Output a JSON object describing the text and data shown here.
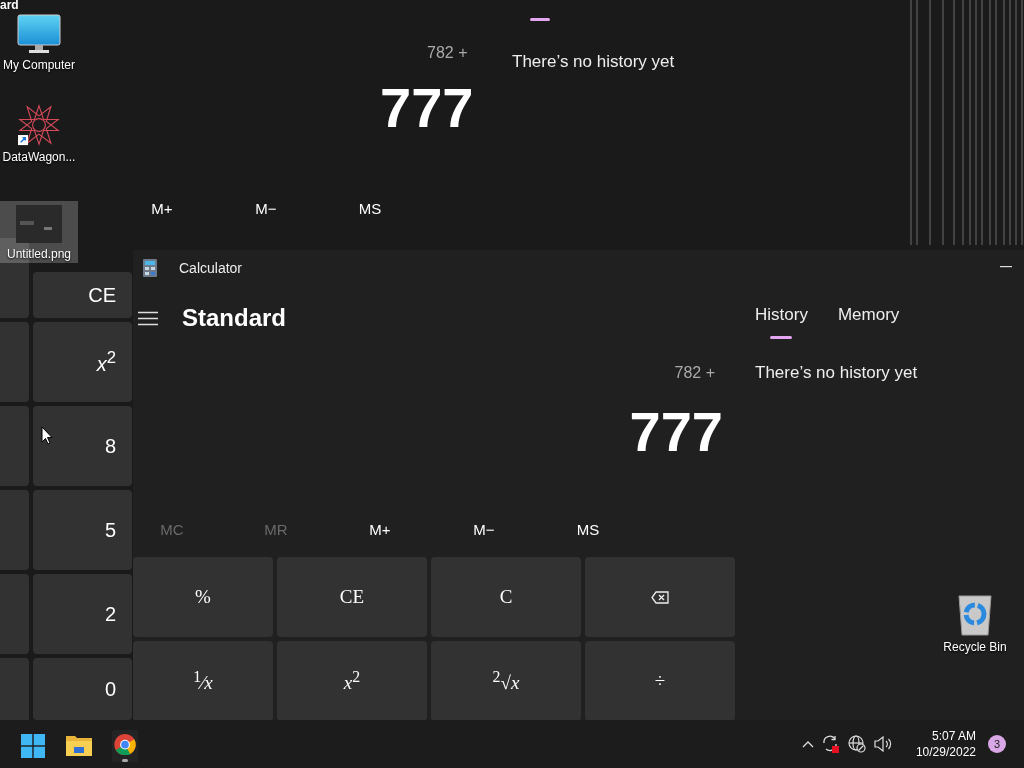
{
  "desktop_icons": [
    {
      "label": "My Computer",
      "kind": "computer",
      "selected": false
    },
    {
      "label": "DataWagon...",
      "kind": "app",
      "selected": false
    },
    {
      "label": "Untitled.png",
      "kind": "image",
      "selected": true
    },
    {
      "label": "Recycle Bin",
      "kind": "bin",
      "selected": false
    }
  ],
  "ghost_window": {
    "mode_fragment": "ard",
    "expression": "782 +",
    "display": "777",
    "memory_buttons": [
      "M+",
      "M−",
      "MS"
    ],
    "history_empty": "There’s no history yet",
    "keys": [
      "CE",
      "*x*$^{2}$",
      "8",
      "5",
      "2",
      "0"
    ]
  },
  "calculator": {
    "title": "Calculator",
    "mode": "Standard",
    "tabs": [
      {
        "label": "History",
        "selected": true
      },
      {
        "label": "Memory",
        "selected": false
      }
    ],
    "expression": "782 +",
    "display": "777",
    "memory_buttons": [
      {
        "label": "MC",
        "disabled": true
      },
      {
        "label": "MR",
        "disabled": true
      },
      {
        "label": "M+",
        "disabled": false
      },
      {
        "label": "M−",
        "disabled": false
      },
      {
        "label": "MS",
        "disabled": false
      }
    ],
    "keys": [
      {
        "kind": "text",
        "label": "%"
      },
      {
        "kind": "text",
        "label": "CE"
      },
      {
        "kind": "text",
        "label": "C"
      },
      {
        "kind": "backspace"
      },
      {
        "kind": "text",
        "label": "$^{1}$⁄*x*"
      },
      {
        "kind": "text",
        "label": "*x*$^{2}$"
      },
      {
        "kind": "text",
        "label": "$^{2}$√*x*"
      },
      {
        "kind": "text",
        "label": "÷"
      }
    ],
    "history_empty": "There’s no history yet"
  },
  "taskbar": {
    "apps": [
      {
        "kind": "start",
        "running": false
      },
      {
        "kind": "folder",
        "running": false
      },
      {
        "kind": "browser",
        "running": true
      }
    ],
    "tray": [
      {
        "kind": "chevron"
      },
      {
        "kind": "sync"
      },
      {
        "kind": "network"
      },
      {
        "kind": "volume"
      }
    ],
    "time": "5:07 AM",
    "date": "10/29/2022",
    "notification_count": "3"
  }
}
